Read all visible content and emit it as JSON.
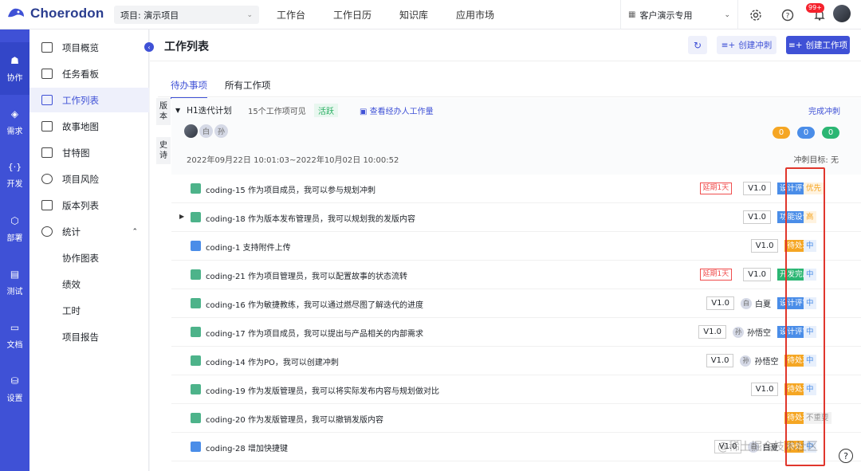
{
  "app": {
    "name": "Choerodon",
    "project_select": "项目: 演示项目"
  },
  "top_nav": [
    "工作台",
    "工作日历",
    "知识库",
    "应用市场"
  ],
  "org_select": "客户演示专用",
  "notifications_badge": "99+",
  "left_nav": [
    {
      "label": "协作",
      "icon": "collab-icon"
    },
    {
      "label": "需求",
      "icon": "layers-icon"
    },
    {
      "label": "开发",
      "icon": "code-icon"
    },
    {
      "label": "部署",
      "icon": "deploy-icon"
    },
    {
      "label": "测试",
      "icon": "clipboard-icon"
    },
    {
      "label": "文档",
      "icon": "inbox-icon"
    },
    {
      "label": "设置",
      "icon": "settings-icon"
    }
  ],
  "sub_nav": {
    "items": [
      {
        "label": "项目概览",
        "icon": "chart-icon"
      },
      {
        "label": "任务看板",
        "icon": "board-icon"
      },
      {
        "label": "工作列表",
        "icon": "list-icon"
      },
      {
        "label": "故事地图",
        "icon": "map-icon"
      },
      {
        "label": "甘特图",
        "icon": "gantt-icon"
      },
      {
        "label": "项目风险",
        "icon": "risk-icon"
      },
      {
        "label": "版本列表",
        "icon": "version-icon"
      },
      {
        "label": "统计",
        "icon": "stats-icon"
      }
    ],
    "children": [
      "协作图表",
      "绩效",
      "工时",
      "项目报告"
    ]
  },
  "page": {
    "title": "工作列表",
    "refresh_label": "C",
    "create_sprint_label": "创建冲刺",
    "create_issue_label": "创建工作项"
  },
  "tabs": [
    "待办事项",
    "所有工作项"
  ],
  "side_tabs": [
    "版本",
    "史诗"
  ],
  "sprint": {
    "name": "H1迭代计划",
    "count": "15个工作项可见",
    "state": "活跃",
    "workload_link": "查看经办人工作量",
    "finish_label": "完成冲刺",
    "avatars": [
      "白",
      "孙"
    ],
    "pills": [
      {
        "value": "0",
        "color": "#f5a623"
      },
      {
        "value": "0",
        "color": "#4a8de8"
      },
      {
        "value": "0",
        "color": "#2bb673"
      }
    ],
    "date_range": "2022年09月22日 10:01:03~2022年10月02日 10:00:52",
    "goal": "冲刺目标: 无"
  },
  "issues": [
    {
      "summary": "coding-15 作为项目成员，我可以参与规划冲刺",
      "type": "story",
      "delay": "延期1天",
      "version": "V1.0",
      "assignee": "",
      "status": "设计评审",
      "status_color": "#4a8de8",
      "priority": "优先",
      "priority_color": "#f5a623",
      "priority_bg": "#fff3e0",
      "expandable": false
    },
    {
      "summary": "coding-18 作为版本发布管理员，我可以规划我的发版内容",
      "type": "story",
      "delay": "",
      "version": "V1.0",
      "assignee": "",
      "status": "功能设计",
      "status_color": "#4a8de8",
      "priority": "高",
      "priority_color": "#f5a623",
      "priority_bg": "#fff3e0",
      "expandable": true
    },
    {
      "summary": "coding-1 支持附件上传",
      "type": "task",
      "delay": "",
      "version": "V1.0",
      "assignee": "",
      "status": "待处理",
      "status_color": "#f5a623",
      "priority": "中",
      "priority_color": "#4a8de8",
      "priority_bg": "#e8f0fc",
      "expandable": false
    },
    {
      "summary": "coding-21 作为项目管理员，我可以配置故事的状态流转",
      "type": "story",
      "delay": "延期1天",
      "version": "V1.0",
      "assignee": "",
      "status": "开发完成",
      "status_color": "#2bb673",
      "priority": "中",
      "priority_color": "#4a8de8",
      "priority_bg": "#e8f0fc",
      "expandable": false
    },
    {
      "summary": "coding-16 作为敏捷教练，我可以通过燃尽图了解迭代的进度",
      "type": "story",
      "delay": "",
      "version": "V1.0",
      "assignee": "白夏",
      "assignee_initial": "白",
      "status": "设计评审",
      "status_color": "#4a8de8",
      "priority": "中",
      "priority_color": "#4a8de8",
      "priority_bg": "#e8f0fc",
      "expandable": false
    },
    {
      "summary": "coding-17 作为项目成员，我可以提出与产品相关的内部需求",
      "type": "story",
      "delay": "",
      "version": "V1.0",
      "assignee": "孙悟空",
      "assignee_initial": "孙",
      "status": "设计评审",
      "status_color": "#4a8de8",
      "priority": "中",
      "priority_color": "#4a8de8",
      "priority_bg": "#e8f0fc",
      "expandable": false
    },
    {
      "summary": "coding-14 作为PO，我可以创建冲刺",
      "type": "story",
      "delay": "",
      "version": "V1.0",
      "assignee": "孙悟空",
      "assignee_initial": "孙",
      "status": "待处理",
      "status_color": "#f5a623",
      "priority": "中",
      "priority_color": "#4a8de8",
      "priority_bg": "#e8f0fc",
      "expandable": false
    },
    {
      "summary": "coding-19 作为发版管理员，我可以将实际发布内容与规划做对比",
      "type": "story",
      "delay": "",
      "version": "V1.0",
      "assignee": "",
      "status": "待处理",
      "status_color": "#f5a623",
      "priority": "中",
      "priority_color": "#4a8de8",
      "priority_bg": "#e8f0fc",
      "expandable": false
    },
    {
      "summary": "coding-20 作为发版管理员，我可以撤销发版内容",
      "type": "story",
      "delay": "",
      "version": "",
      "assignee": "",
      "status": "待处理",
      "status_color": "#f5a623",
      "priority": "不重要",
      "priority_color": "#999999",
      "priority_bg": "#f2f2f2",
      "expandable": false
    },
    {
      "summary": "coding-28 增加快捷键",
      "type": "task",
      "delay": "",
      "version": "V1.0",
      "assignee": "白夏",
      "assignee_initial": "白",
      "status": "待处理",
      "status_color": "#f5a623",
      "priority": "中",
      "priority_color": "#4a8de8",
      "priority_bg": "#e8f0fc",
      "expandable": false
    }
  ],
  "watermark": "@稀土掘金技术社区",
  "help_label": "?"
}
